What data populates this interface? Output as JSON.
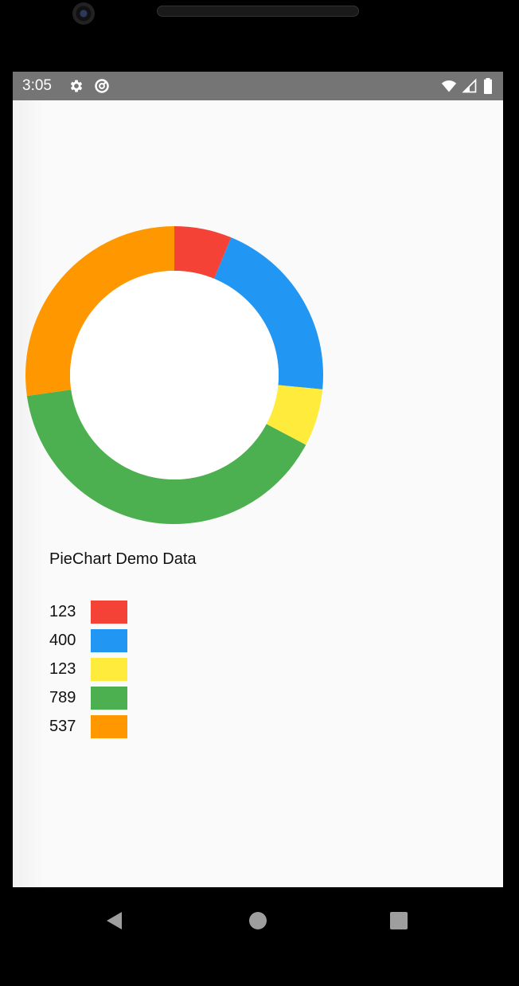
{
  "status_bar": {
    "time": "3:05",
    "icons": [
      "gear-icon",
      "at-sign-icon",
      "wifi-icon",
      "signal-icon",
      "battery-icon"
    ]
  },
  "chart_data": {
    "type": "pie",
    "style": "donut",
    "title": "PieChart Demo Data",
    "categories": [
      "123",
      "400",
      "123",
      "789",
      "537"
    ],
    "values": [
      123,
      400,
      123,
      789,
      537
    ],
    "colors": [
      "#f44336",
      "#2196f3",
      "#ffeb3b",
      "#4caf50",
      "#ff9800"
    ]
  },
  "navigation": {
    "back": "back-icon",
    "home": "home-icon",
    "recents": "recents-icon"
  }
}
